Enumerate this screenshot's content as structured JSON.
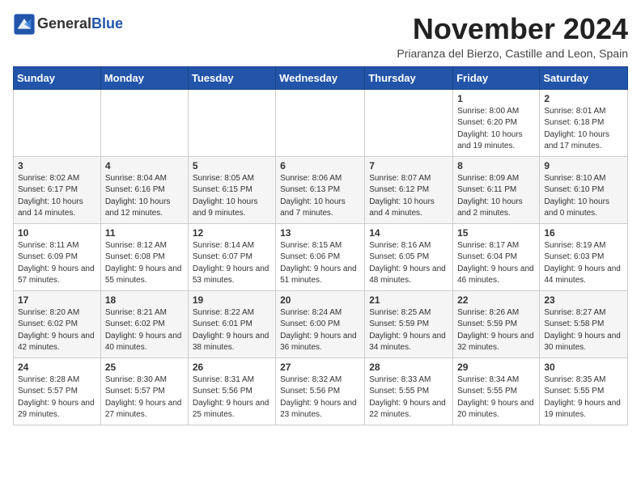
{
  "header": {
    "logo_line1": "General",
    "logo_line2": "Blue",
    "month_year": "November 2024",
    "location": "Priaranza del Bierzo, Castille and Leon, Spain"
  },
  "days_of_week": [
    "Sunday",
    "Monday",
    "Tuesday",
    "Wednesday",
    "Thursday",
    "Friday",
    "Saturday"
  ],
  "weeks": [
    [
      {
        "day": "",
        "info": ""
      },
      {
        "day": "",
        "info": ""
      },
      {
        "day": "",
        "info": ""
      },
      {
        "day": "",
        "info": ""
      },
      {
        "day": "",
        "info": ""
      },
      {
        "day": "1",
        "info": "Sunrise: 8:00 AM\nSunset: 6:20 PM\nDaylight: 10 hours and 19 minutes."
      },
      {
        "day": "2",
        "info": "Sunrise: 8:01 AM\nSunset: 6:18 PM\nDaylight: 10 hours and 17 minutes."
      }
    ],
    [
      {
        "day": "3",
        "info": "Sunrise: 8:02 AM\nSunset: 6:17 PM\nDaylight: 10 hours and 14 minutes."
      },
      {
        "day": "4",
        "info": "Sunrise: 8:04 AM\nSunset: 6:16 PM\nDaylight: 10 hours and 12 minutes."
      },
      {
        "day": "5",
        "info": "Sunrise: 8:05 AM\nSunset: 6:15 PM\nDaylight: 10 hours and 9 minutes."
      },
      {
        "day": "6",
        "info": "Sunrise: 8:06 AM\nSunset: 6:13 PM\nDaylight: 10 hours and 7 minutes."
      },
      {
        "day": "7",
        "info": "Sunrise: 8:07 AM\nSunset: 6:12 PM\nDaylight: 10 hours and 4 minutes."
      },
      {
        "day": "8",
        "info": "Sunrise: 8:09 AM\nSunset: 6:11 PM\nDaylight: 10 hours and 2 minutes."
      },
      {
        "day": "9",
        "info": "Sunrise: 8:10 AM\nSunset: 6:10 PM\nDaylight: 10 hours and 0 minutes."
      }
    ],
    [
      {
        "day": "10",
        "info": "Sunrise: 8:11 AM\nSunset: 6:09 PM\nDaylight: 9 hours and 57 minutes."
      },
      {
        "day": "11",
        "info": "Sunrise: 8:12 AM\nSunset: 6:08 PM\nDaylight: 9 hours and 55 minutes."
      },
      {
        "day": "12",
        "info": "Sunrise: 8:14 AM\nSunset: 6:07 PM\nDaylight: 9 hours and 53 minutes."
      },
      {
        "day": "13",
        "info": "Sunrise: 8:15 AM\nSunset: 6:06 PM\nDaylight: 9 hours and 51 minutes."
      },
      {
        "day": "14",
        "info": "Sunrise: 8:16 AM\nSunset: 6:05 PM\nDaylight: 9 hours and 48 minutes."
      },
      {
        "day": "15",
        "info": "Sunrise: 8:17 AM\nSunset: 6:04 PM\nDaylight: 9 hours and 46 minutes."
      },
      {
        "day": "16",
        "info": "Sunrise: 8:19 AM\nSunset: 6:03 PM\nDaylight: 9 hours and 44 minutes."
      }
    ],
    [
      {
        "day": "17",
        "info": "Sunrise: 8:20 AM\nSunset: 6:02 PM\nDaylight: 9 hours and 42 minutes."
      },
      {
        "day": "18",
        "info": "Sunrise: 8:21 AM\nSunset: 6:02 PM\nDaylight: 9 hours and 40 minutes."
      },
      {
        "day": "19",
        "info": "Sunrise: 8:22 AM\nSunset: 6:01 PM\nDaylight: 9 hours and 38 minutes."
      },
      {
        "day": "20",
        "info": "Sunrise: 8:24 AM\nSunset: 6:00 PM\nDaylight: 9 hours and 36 minutes."
      },
      {
        "day": "21",
        "info": "Sunrise: 8:25 AM\nSunset: 5:59 PM\nDaylight: 9 hours and 34 minutes."
      },
      {
        "day": "22",
        "info": "Sunrise: 8:26 AM\nSunset: 5:59 PM\nDaylight: 9 hours and 32 minutes."
      },
      {
        "day": "23",
        "info": "Sunrise: 8:27 AM\nSunset: 5:58 PM\nDaylight: 9 hours and 30 minutes."
      }
    ],
    [
      {
        "day": "24",
        "info": "Sunrise: 8:28 AM\nSunset: 5:57 PM\nDaylight: 9 hours and 29 minutes."
      },
      {
        "day": "25",
        "info": "Sunrise: 8:30 AM\nSunset: 5:57 PM\nDaylight: 9 hours and 27 minutes."
      },
      {
        "day": "26",
        "info": "Sunrise: 8:31 AM\nSunset: 5:56 PM\nDaylight: 9 hours and 25 minutes."
      },
      {
        "day": "27",
        "info": "Sunrise: 8:32 AM\nSunset: 5:56 PM\nDaylight: 9 hours and 23 minutes."
      },
      {
        "day": "28",
        "info": "Sunrise: 8:33 AM\nSunset: 5:55 PM\nDaylight: 9 hours and 22 minutes."
      },
      {
        "day": "29",
        "info": "Sunrise: 8:34 AM\nSunset: 5:55 PM\nDaylight: 9 hours and 20 minutes."
      },
      {
        "day": "30",
        "info": "Sunrise: 8:35 AM\nSunset: 5:55 PM\nDaylight: 9 hours and 19 minutes."
      }
    ]
  ]
}
